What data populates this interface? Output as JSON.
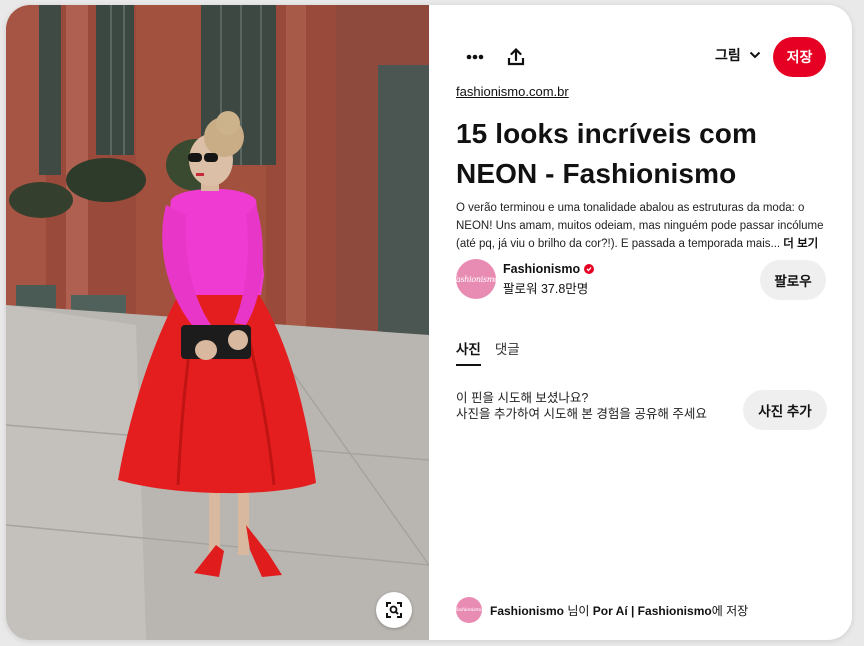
{
  "toolbar": {
    "more_icon": "ellipsis-icon",
    "share_icon": "share-upload-icon",
    "board_label": "그림",
    "save_label": "저장"
  },
  "pin": {
    "source": "fashionismo.com.br",
    "title": "15 looks incríveis com NEON - Fashionismo",
    "description": "O verão terminou e uma tonalidade abalou as estruturas da moda: o NEON! Uns amam, muitos odeiam, mas ninguém pode passar incólume (até pq, já viu o brilho da cor?!). E passada a temporada mais...",
    "more_label": "더 보기"
  },
  "creator": {
    "avatar_text": "fashionismo",
    "name": "Fashionismo",
    "followers": "팔로워 37.8만명",
    "follow_label": "팔로우"
  },
  "tabs": [
    {
      "label": "사진",
      "active": true
    },
    {
      "label": "댓글",
      "active": false
    }
  ],
  "try_it": {
    "line1": "이 핀을 시도해 보셨나요?",
    "line2": "사진을 추가하여 시도해 본 경험을 공유해 주세요",
    "button": "사진 추가"
  },
  "saved_by": {
    "user": "Fashionismo",
    "mid": " 님이 ",
    "board": "Por Aí | Fashionismo",
    "suffix": "에 저장"
  },
  "colors": {
    "brand_red": "#e60023",
    "button_gray": "#efefef",
    "avatar_pink": "#e98cb4"
  },
  "image": {
    "description_icon": "visual-search-icon"
  }
}
